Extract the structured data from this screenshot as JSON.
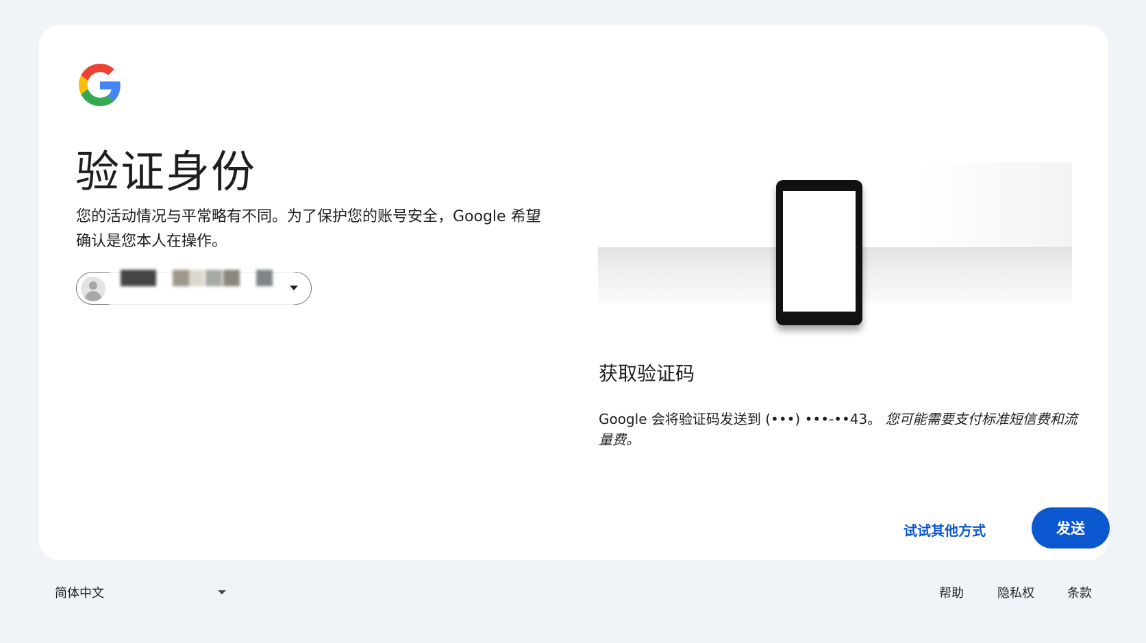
{
  "brand": {
    "logo_icon": "google-g-logo-icon",
    "colors": {
      "blue": "#4285F4",
      "red": "#EA4335",
      "yellow": "#FBBC05",
      "green": "#34A853"
    }
  },
  "page": {
    "title": "验证身份",
    "description": "您的活动情况与平常略有不同。为了保护您的账号安全，Google 希望确认是您本人在操作。"
  },
  "account_chip": {
    "avatar_icon": "default-avatar-icon",
    "email": "",
    "dropdown_icon": "chevron-down-icon"
  },
  "verification": {
    "illustration": "phone-illustration",
    "heading": "获取验证码",
    "sms_text": "Google 会将验证码发送到 (•••) •••-••43。",
    "fee_note": "您可能需要支付标准短信费和流量费。"
  },
  "actions": {
    "try_another_label": "试试其他方式",
    "send_label": "发送"
  },
  "footer": {
    "language": "简体中文",
    "help": "帮助",
    "privacy": "隐私权",
    "terms": "条款"
  },
  "accent_color": "#0b57d0"
}
